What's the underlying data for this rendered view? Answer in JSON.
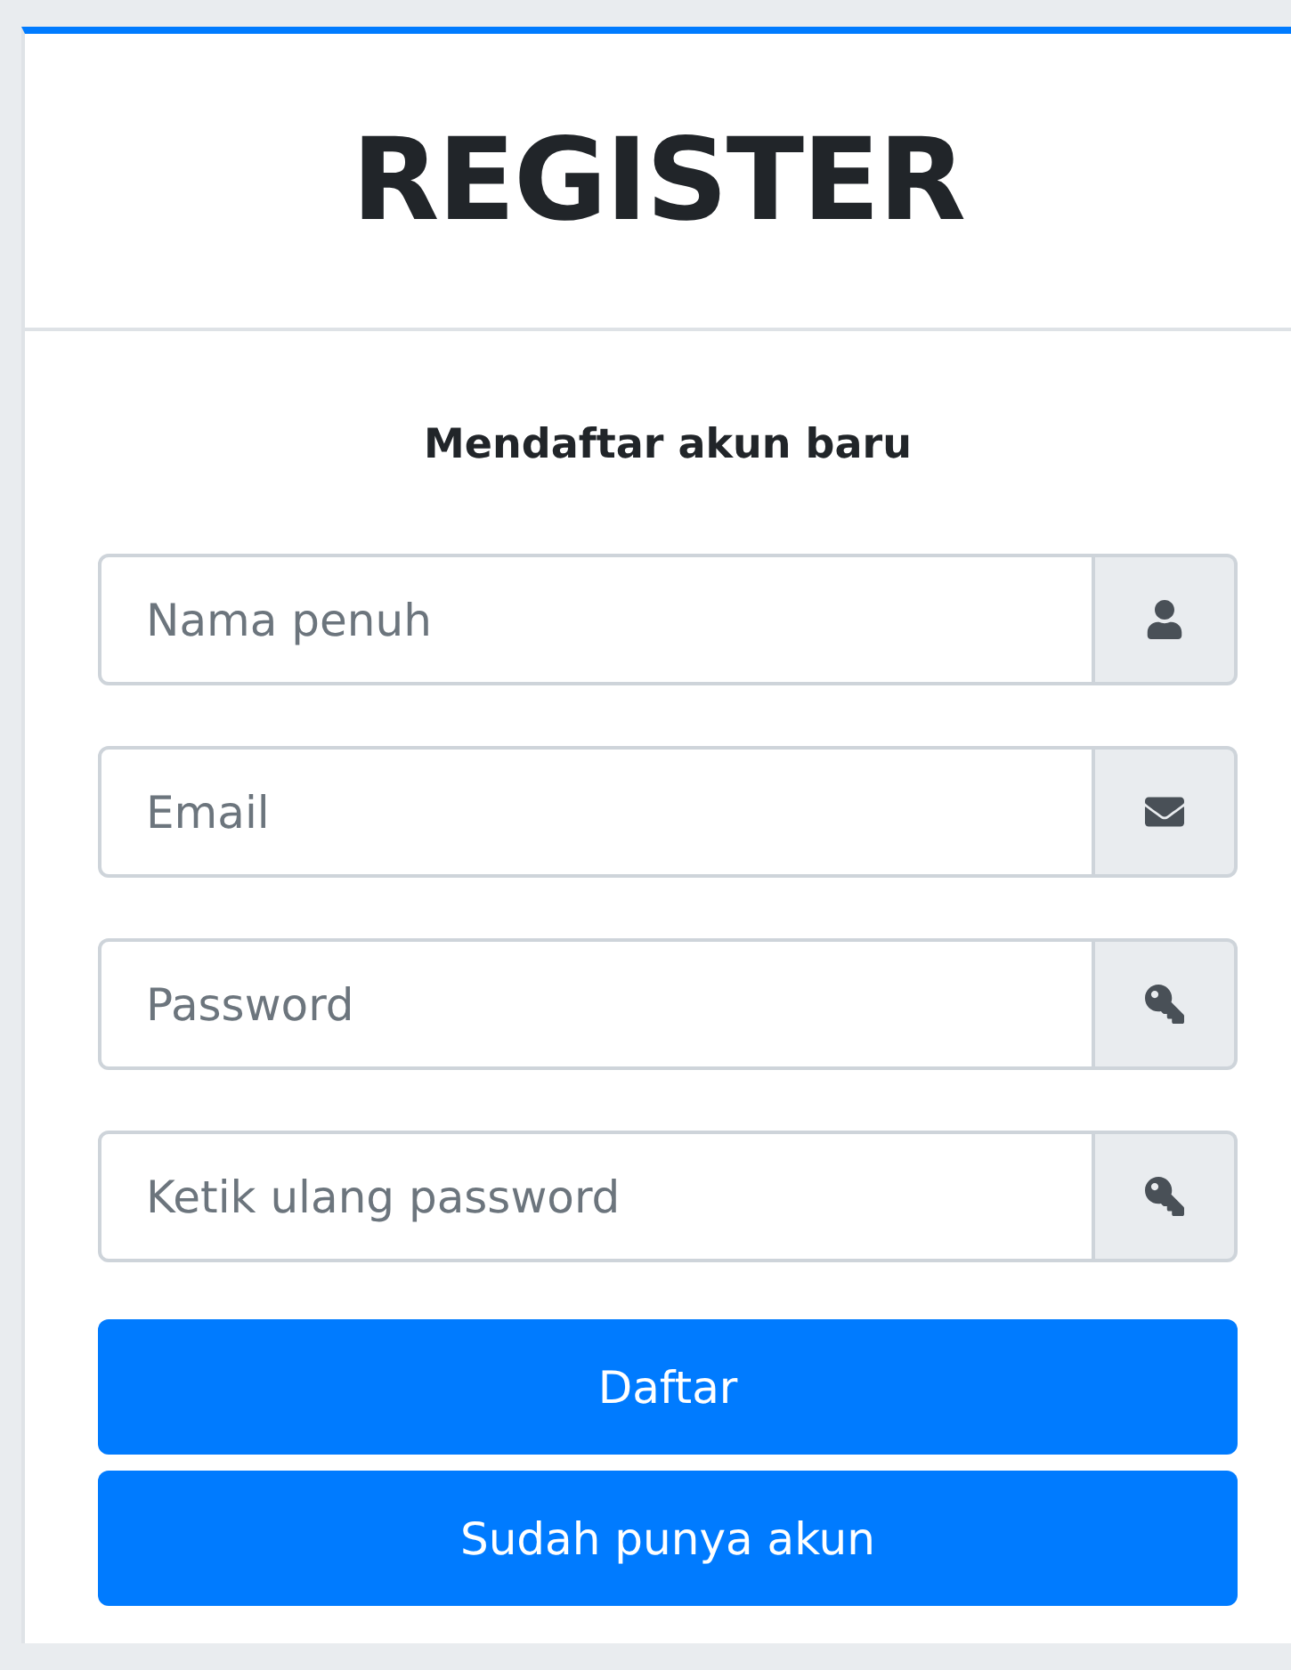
{
  "card": {
    "title": "REGISTER",
    "subtitle": "Mendaftar akun baru"
  },
  "fields": [
    {
      "placeholder": "Nama penuh",
      "kind": "user"
    },
    {
      "placeholder": "Email",
      "kind": "envelope"
    },
    {
      "placeholder": "Password",
      "kind": "key"
    },
    {
      "placeholder": "Ketik ulang password",
      "kind": "key"
    }
  ],
  "buttons": [
    "Daftar",
    "Sudah punya akun"
  ]
}
